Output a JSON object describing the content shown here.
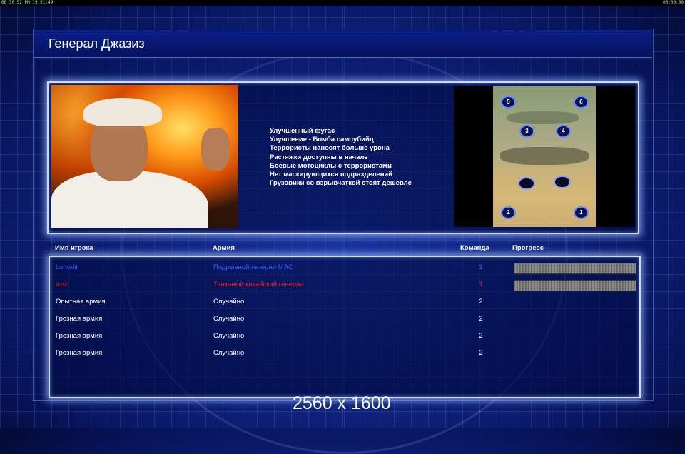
{
  "topbar": {
    "left_text": "08 30 52 PM 19:51:49",
    "right_text": "00:00:00"
  },
  "title": "Генерал Джазиз",
  "bonuses": [
    "Улучшенный фугас",
    "Улучшение - Бомба самоубийц",
    "Террористы наносят больше урона",
    "Растяжки доступны в начале",
    "Боевые мотоциклы с террористами",
    "Нет маскирующихся подразделений",
    "Грузовики со взрывчаткой стоят дешевле"
  ],
  "minimap": {
    "spots": [
      "5",
      "6",
      "3",
      "4",
      "2",
      "1"
    ]
  },
  "table": {
    "headers": {
      "name": "Имя игрока",
      "army": "Армия",
      "team": "Команда",
      "progress": "Прогресс"
    },
    "rows": [
      {
        "name": "bohodir",
        "army": "Подрывной генерал МАО",
        "team": "1",
        "color": "#3a5cff",
        "progress": 1
      },
      {
        "name": "aziz",
        "army": "Танковый китайский генерал",
        "team": "1",
        "color": "#ff1a1a",
        "progress": 1
      },
      {
        "name": "Опытная армия",
        "army": "Случайно",
        "team": "2",
        "color": "#ffffff"
      },
      {
        "name": "Грозная армия",
        "army": "Случайно",
        "team": "2",
        "color": "#ffffff"
      },
      {
        "name": "Грозная армия",
        "army": "Случайно",
        "team": "2",
        "color": "#ffffff"
      },
      {
        "name": "Грозная армия",
        "army": "Случайно",
        "team": "2",
        "color": "#ffffff"
      }
    ]
  },
  "watermark": "2560 x 1600"
}
